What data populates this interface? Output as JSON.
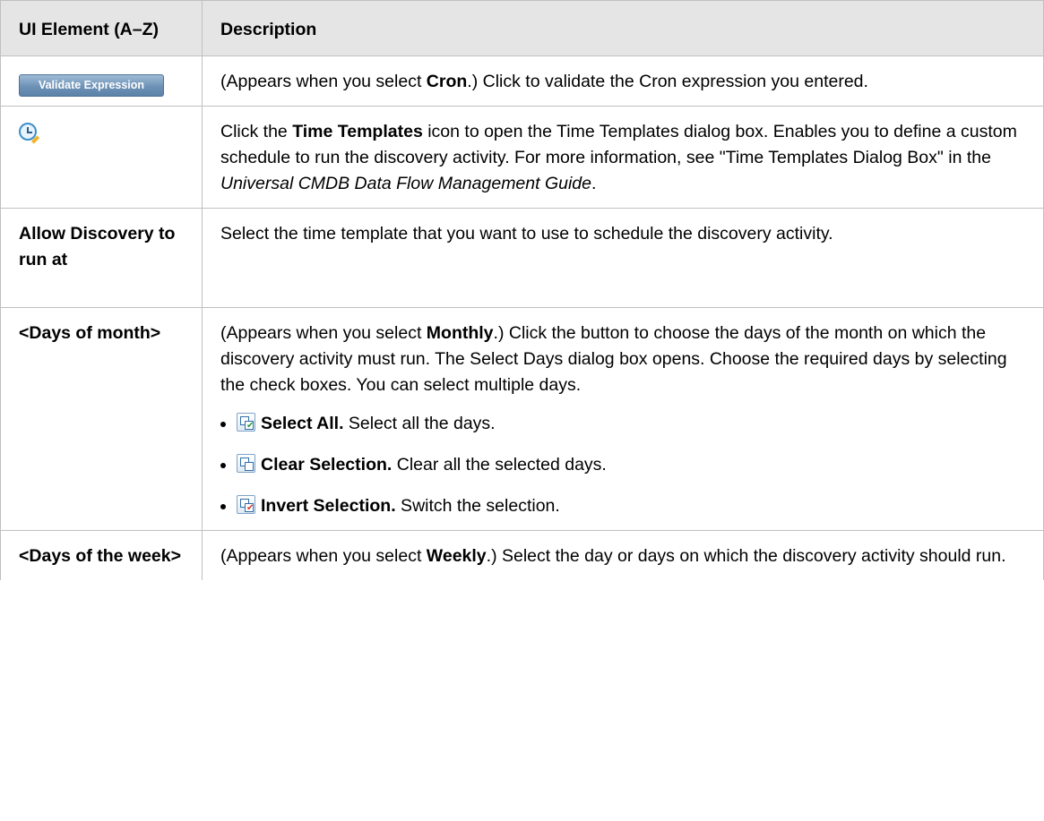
{
  "header": {
    "col1": "UI Element (A–Z)",
    "col2": "Description"
  },
  "rows": {
    "validate": {
      "button_label": "Validate Expression",
      "desc": {
        "pre": "(Appears when you select ",
        "bold": "Cron",
        "post": ".) Click to validate the Cron expression you entered."
      }
    },
    "time_templates": {
      "icon": "time-templates-icon",
      "desc": {
        "pre": "Click the ",
        "bold": "Time Templates",
        "mid": " icon to open the Time Templates dialog box. Enables you to define a custom schedule to run the discovery activity. For more information, see \"Time Templates Dialog Box\" in the ",
        "italic": "Universal CMDB Data Flow Management Guide",
        "post": "."
      }
    },
    "allow": {
      "element": "Allow Discovery to run at",
      "desc": "Select the time template that you want to use to schedule the discovery activity."
    },
    "days_of_month": {
      "element": "<Days of month>",
      "desc": {
        "pre": "(Appears when you select ",
        "bold": "Monthly",
        "post": ".) Click the button to choose the days of the month on which the discovery activity must run. The Select Days dialog box opens. Choose the required days by selecting the check boxes. You can select multiple days."
      },
      "items": [
        {
          "icon": "select-all-icon",
          "bold": "Select All.",
          "text": " Select all the days."
        },
        {
          "icon": "clear-selection-icon",
          "bold": "Clear Selection.",
          "text": " Clear all the selected days."
        },
        {
          "icon": "invert-selection-icon",
          "bold": "Invert Selection.",
          "text": " Switch the selection."
        }
      ]
    },
    "days_of_week": {
      "element": "<Days of the week>",
      "desc": {
        "pre": "(Appears when you select ",
        "bold": "Weekly",
        "post": ".) Select the day or days on which the discovery activity should run."
      }
    }
  }
}
